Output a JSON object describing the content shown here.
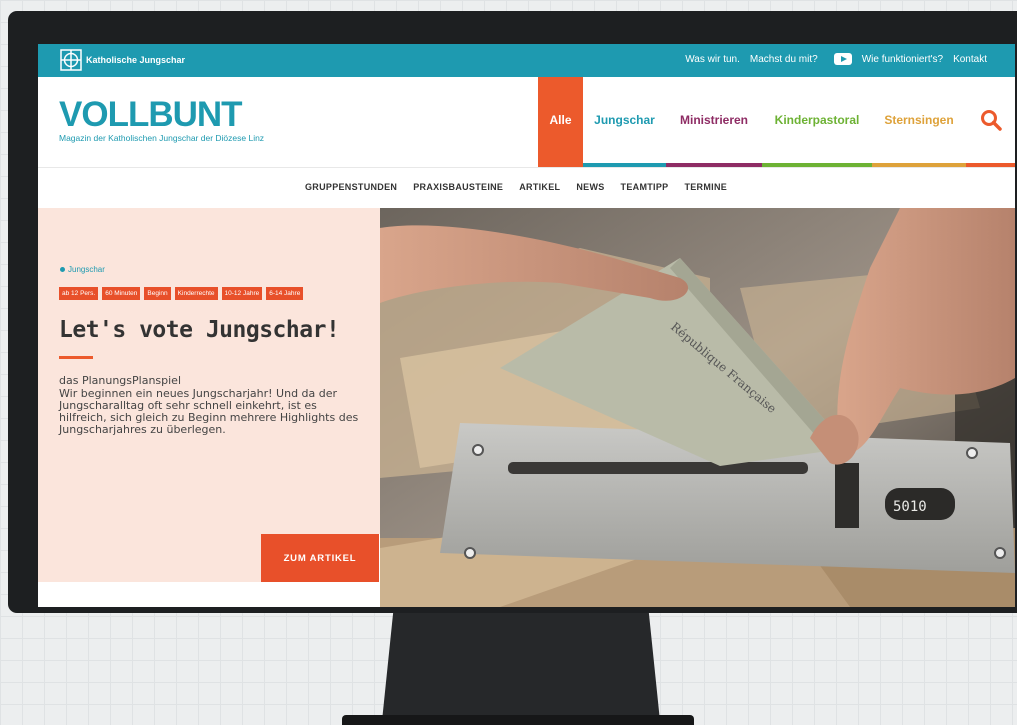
{
  "topbar": {
    "brand": "Katholische Jungschar",
    "links": [
      "Was wir tun.",
      "Machst du mit?",
      "Wie funktioniert's?",
      "Kontakt"
    ]
  },
  "header": {
    "logo": "VOLLBUNT",
    "tagline": "Magazin der Katholischen Jungschar der Diözese Linz",
    "categories": [
      "Alle",
      "Jungschar",
      "Ministrieren",
      "Kinderpastoral",
      "Sternsingen"
    ]
  },
  "subnav": {
    "items": [
      "GRUPPENSTUNDEN",
      "PRAXISBAUSTEINE",
      "ARTIKEL",
      "NEWS",
      "TEAMTIPP",
      "TERMINE"
    ]
  },
  "hero": {
    "category": "Jungschar",
    "badges": [
      "ab 12 Pers.",
      "60 Minuten",
      "Beginn",
      "Kinderrechte",
      "10-12 Jahre",
      "6-14 Jahre"
    ],
    "title": "Let's vote Jungschar!",
    "subtitle": "das PlanungsPlanspiel",
    "description": "Wir beginnen ein neues Jungscharjahr! Und da der Jungscharalltag oft sehr schnell einkehrt, ist es hilfreich, sich gleich zu Beginn mehrere Highlights des Jungscharjahres zu überlegen.",
    "cta": "ZUM ARTIKEL",
    "image_text": "République Française",
    "counter": "5010"
  },
  "colors": {
    "teal": "#1e9ab0",
    "orange": "#ec5a2c",
    "purple": "#8e2c64",
    "green": "#6db234",
    "yellow": "#dea23a"
  }
}
